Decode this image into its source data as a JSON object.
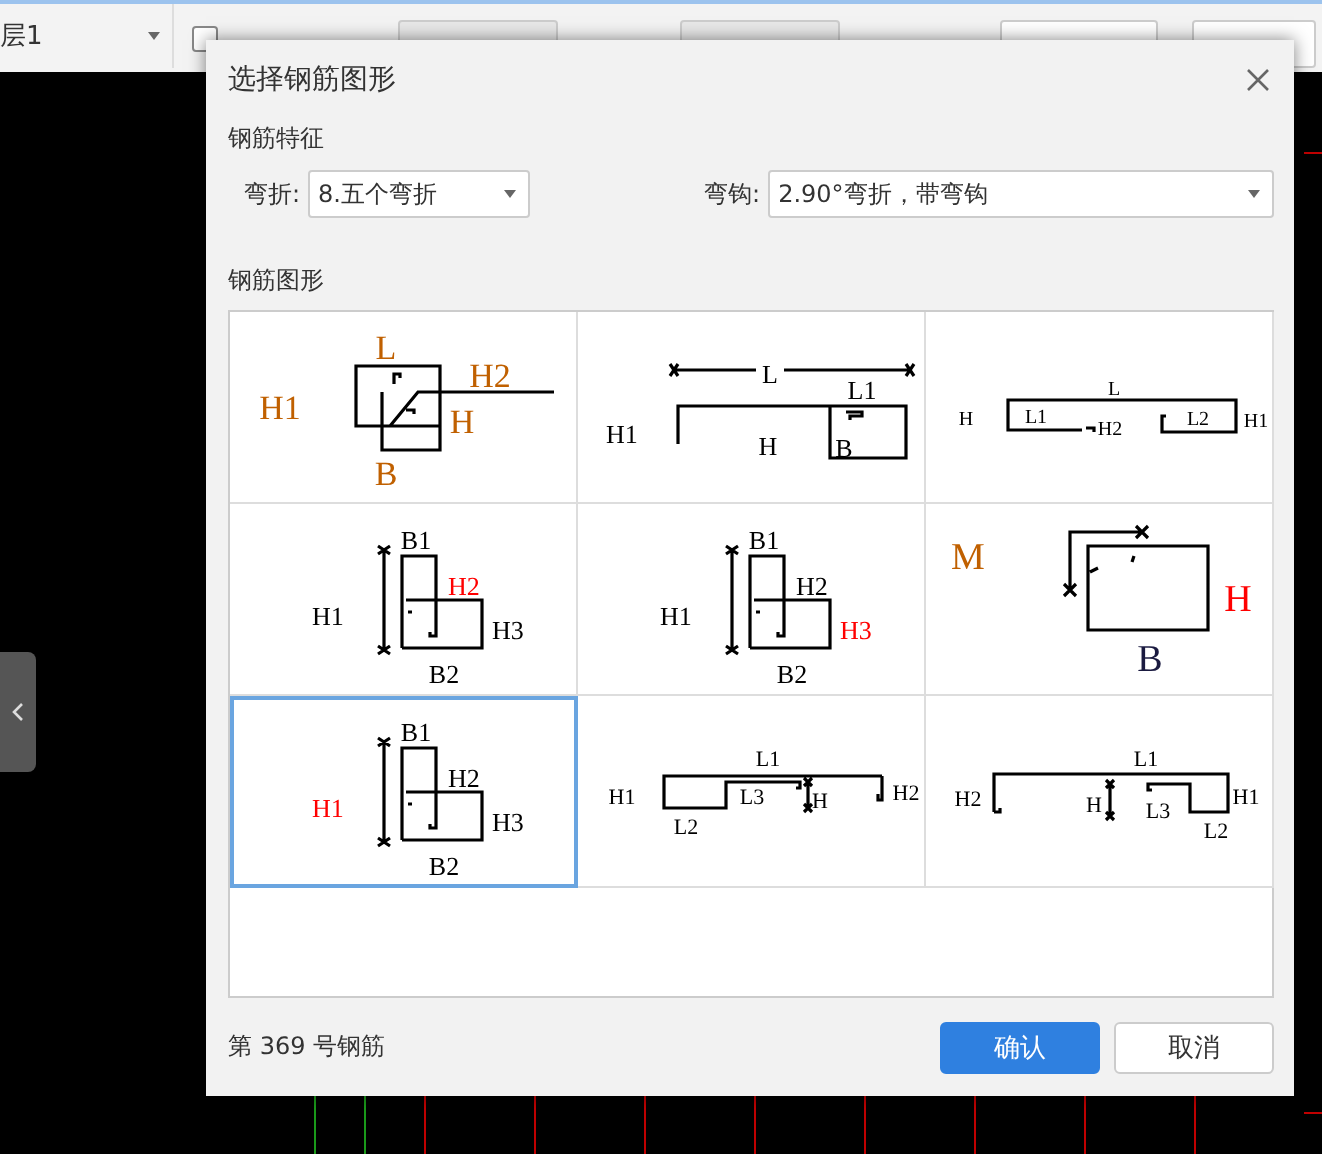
{
  "toolbar": {
    "layer_select": "层1",
    "checkbox": {
      "checked": false
    }
  },
  "dialog": {
    "title": "选择钢筋图形",
    "features_heading": "钢筋特征",
    "bend": {
      "label": "弯折:",
      "value": "8.五个弯折"
    },
    "hook": {
      "label": "弯钩:",
      "value": "2.90°弯折，带弯钩"
    },
    "shapes_heading": "钢筋图形",
    "shapes": [
      {
        "selected": false,
        "labels": [
          {
            "text": "H1",
            "color": "#c06000"
          },
          {
            "text": "L",
            "color": "#c06000"
          },
          {
            "text": "H2",
            "color": "#c06000"
          },
          {
            "text": "H",
            "color": "#c06000"
          },
          {
            "text": "B",
            "color": "#c06000"
          }
        ]
      },
      {
        "selected": false,
        "labels": [
          {
            "text": "L",
            "color": "#000000"
          },
          {
            "text": "L1",
            "color": "#000000"
          },
          {
            "text": "H1",
            "color": "#000000"
          },
          {
            "text": "H",
            "color": "#000000"
          },
          {
            "text": "B",
            "color": "#000000"
          }
        ]
      },
      {
        "selected": false,
        "labels": [
          {
            "text": "L",
            "color": "#000000"
          },
          {
            "text": "H",
            "color": "#000000"
          },
          {
            "text": "L1",
            "color": "#000000"
          },
          {
            "text": "H2",
            "color": "#000000"
          },
          {
            "text": "L2",
            "color": "#000000"
          },
          {
            "text": "H1",
            "color": "#000000"
          }
        ]
      },
      {
        "selected": false,
        "labels": [
          {
            "text": "B1",
            "color": "#000000"
          },
          {
            "text": "H2",
            "color": "#ff0000"
          },
          {
            "text": "H1",
            "color": "#000000"
          },
          {
            "text": "H3",
            "color": "#000000"
          },
          {
            "text": "B2",
            "color": "#000000"
          }
        ]
      },
      {
        "selected": false,
        "labels": [
          {
            "text": "B1",
            "color": "#000000"
          },
          {
            "text": "H2",
            "color": "#000000"
          },
          {
            "text": "H1",
            "color": "#000000"
          },
          {
            "text": "H3",
            "color": "#ff0000"
          },
          {
            "text": "B2",
            "color": "#000000"
          }
        ]
      },
      {
        "selected": false,
        "labels": [
          {
            "text": "M",
            "color": "#c06000"
          },
          {
            "text": "H",
            "color": "#ff0000"
          },
          {
            "text": "B",
            "color": "#1a1a40"
          }
        ]
      },
      {
        "selected": true,
        "labels": [
          {
            "text": "B1",
            "color": "#000000"
          },
          {
            "text": "H2",
            "color": "#000000"
          },
          {
            "text": "H1",
            "color": "#ff0000"
          },
          {
            "text": "H3",
            "color": "#000000"
          },
          {
            "text": "B2",
            "color": "#000000"
          }
        ]
      },
      {
        "selected": false,
        "labels": [
          {
            "text": "L1",
            "color": "#000000"
          },
          {
            "text": "H1",
            "color": "#000000"
          },
          {
            "text": "L3",
            "color": "#000000"
          },
          {
            "text": "H",
            "color": "#000000"
          },
          {
            "text": "H2",
            "color": "#000000"
          },
          {
            "text": "L2",
            "color": "#000000"
          }
        ]
      },
      {
        "selected": false,
        "labels": [
          {
            "text": "L1",
            "color": "#000000"
          },
          {
            "text": "H2",
            "color": "#000000"
          },
          {
            "text": "H",
            "color": "#000000"
          },
          {
            "text": "L3",
            "color": "#000000"
          },
          {
            "text": "H1",
            "color": "#000000"
          },
          {
            "text": "L2",
            "color": "#000000"
          }
        ]
      }
    ],
    "footer_text": "第 369 号钢筋",
    "buttons": [
      {
        "label": "确认",
        "kind": "primary"
      },
      {
        "label": "取消",
        "kind": "secondary"
      }
    ]
  }
}
